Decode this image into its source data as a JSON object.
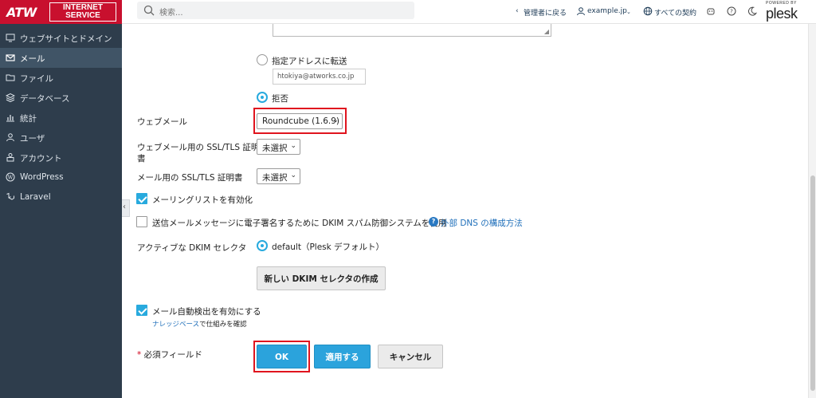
{
  "header": {
    "logo": {
      "left": "ATW",
      "right_line1": "INTERNET",
      "right_line2": "SERVICE"
    },
    "search_placeholder": "検索...",
    "back_to_admin": "管理者に戻る",
    "domain": "example.jp",
    "all_subscriptions": "すべての契約",
    "plesk_powered": "POWERED BY",
    "plesk_word": "plesk"
  },
  "sidebar": {
    "items": [
      {
        "label": "ウェブサイトとドメイン",
        "icon": "monitor-icon"
      },
      {
        "label": "メール",
        "icon": "mail-icon"
      },
      {
        "label": "ファイル",
        "icon": "folder-icon"
      },
      {
        "label": "データベース",
        "icon": "database-icon"
      },
      {
        "label": "統計",
        "icon": "stats-icon"
      },
      {
        "label": "ユーザ",
        "icon": "user-icon"
      },
      {
        "label": "アカウント",
        "icon": "account-icon"
      },
      {
        "label": "WordPress",
        "icon": "wordpress-icon"
      },
      {
        "label": "Laravel",
        "icon": "laravel-icon"
      }
    ],
    "active_index": 1
  },
  "form": {
    "forward_option_label": "指定アドレスに転送",
    "forward_address": "htokiya@atworks.co.jp",
    "reject_option_label": "拒否",
    "webmail_label": "ウェブメール",
    "webmail_value": "Roundcube (1.6.9)",
    "webmail_ssl_label_line1": "ウェブメール用の SSL/TLS 証明",
    "webmail_ssl_label_line2": "書",
    "webmail_ssl_value": "未選択",
    "mail_ssl_label": "メール用の SSL/TLS 証明書",
    "mail_ssl_value": "未選択",
    "mailing_list_label": "メーリングリストを有効化",
    "dkim_sign_label": "送信メールメッセージに電子署名するために DKIM スパム防御システムを使用",
    "external_dns_link": "外部 DNS の構成方法",
    "dkim_selector_label": "アクティブな DKIM セレクタ",
    "dkim_selector_value": "default（Plesk デフォルト）",
    "new_dkim_button": "新しい DKIM セレクタの作成",
    "autodiscover_label": "メール自動検出を有効にする",
    "knowledge_base_link": "ナレッジベース",
    "knowledge_base_suffix": "で仕組みを確認",
    "required_star": "*",
    "required_label": "必須フィールド",
    "ok_button": "OK",
    "apply_button": "適用する",
    "cancel_button": "キャンセル"
  },
  "colors": {
    "accent": "#28aade",
    "sidebar": "#2e3d4c",
    "highlight": "#e0141e",
    "brand": "#c8102e"
  }
}
